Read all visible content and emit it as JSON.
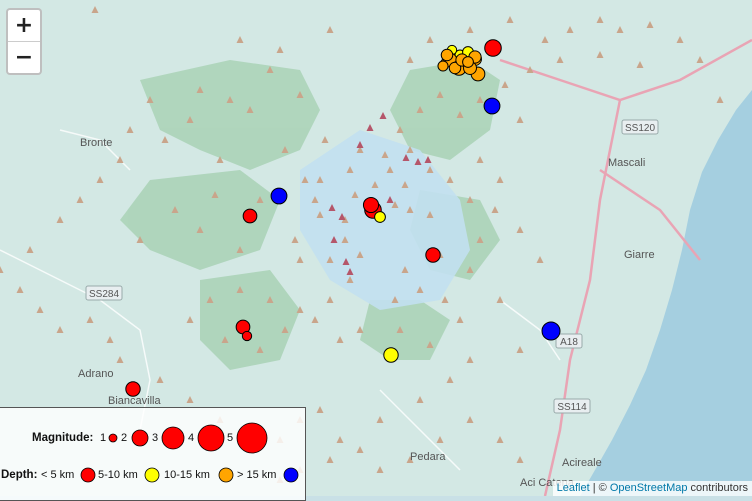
{
  "colors": {
    "sea": "#aad3df",
    "land": "#d6ebe6",
    "forest": "#aed3b8",
    "shallow": "#9fc5ea",
    "depth_lt5": "#ff0000",
    "depth_5_10": "#ffff00",
    "depth_10_15": "#ffa500",
    "depth_gt15": "#0000ff"
  },
  "zoom": {
    "in_label": "+",
    "out_label": "−"
  },
  "places": [
    {
      "id": "bronte",
      "label": "Bronte"
    },
    {
      "id": "mascali",
      "label": "Mascali"
    },
    {
      "id": "giarre",
      "label": "Giarre"
    },
    {
      "id": "adrano",
      "label": "Adrano"
    },
    {
      "id": "biancavilla",
      "label": "Biancavilla"
    },
    {
      "id": "pedara",
      "label": "Pedara"
    },
    {
      "id": "acireale",
      "label": "Acireale"
    },
    {
      "id": "acicatena",
      "label": "Aci Catena"
    }
  ],
  "roads": [
    {
      "id": "ss120",
      "label": "SS120"
    },
    {
      "id": "ss284",
      "label": "SS284"
    },
    {
      "id": "a18",
      "label": "A18"
    },
    {
      "id": "ss114",
      "label": "SS114"
    }
  ],
  "earthquakes": [
    {
      "mag": 2.0,
      "depth": "lt5"
    },
    {
      "mag": 2.2,
      "depth": "gt15"
    },
    {
      "mag": 2.0,
      "depth": "gt15"
    },
    {
      "mag": 2.5,
      "depth": "gt15"
    },
    {
      "mag": 1.9,
      "depth": "lt5"
    },
    {
      "mag": 2.0,
      "depth": "lt5"
    },
    {
      "mag": 2.3,
      "depth": "lt5"
    },
    {
      "mag": 1.5,
      "depth": "5_10"
    },
    {
      "mag": 1.9,
      "depth": "lt5"
    },
    {
      "mag": 2.1,
      "depth": "lt5"
    },
    {
      "mag": 1.3,
      "depth": "lt5"
    },
    {
      "mag": 2.0,
      "depth": "5_10"
    },
    {
      "mag": 2.2,
      "depth": "gt15"
    },
    {
      "mag": 2.3,
      "depth": "lt5"
    },
    {
      "mag": 1.4,
      "depth": "5_10"
    },
    {
      "mag": 1.2,
      "depth": "5_10"
    },
    {
      "mag": 1.5,
      "depth": "5_10"
    },
    {
      "mag": 1.3,
      "depth": "5_10"
    },
    {
      "mag": 1.9,
      "depth": "10_15"
    },
    {
      "mag": 2.0,
      "depth": "10_15"
    },
    {
      "mag": 1.8,
      "depth": "10_15"
    },
    {
      "mag": 1.9,
      "depth": "10_15"
    },
    {
      "mag": 1.6,
      "depth": "10_15"
    },
    {
      "mag": 1.7,
      "depth": "10_15"
    },
    {
      "mag": 1.8,
      "depth": "10_15"
    },
    {
      "mag": 1.7,
      "depth": "10_15"
    },
    {
      "mag": 1.5,
      "depth": "10_15"
    },
    {
      "mag": 1.6,
      "depth": "10_15"
    },
    {
      "mag": 1.4,
      "depth": "10_15"
    }
  ],
  "legend": {
    "magnitude_label": "Magnitude:",
    "magnitudes": [
      "1",
      "2",
      "3",
      "4",
      "5"
    ],
    "depth_label": "Depth:",
    "depths": [
      "< 5 km",
      "5-10 km",
      "10-15 km",
      "> 15 km"
    ]
  },
  "attribution": {
    "leaflet": "Leaflet",
    "sep": " | © ",
    "osm": "OpenStreetMap",
    "suffix": " contributors"
  }
}
